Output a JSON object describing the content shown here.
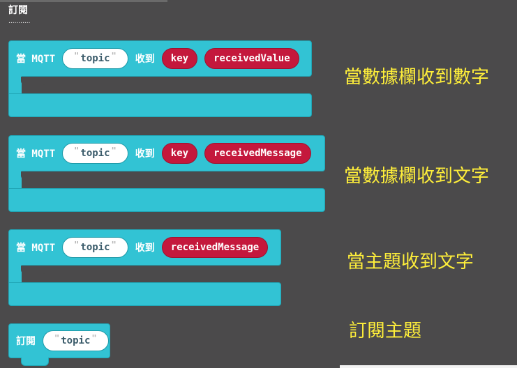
{
  "section": {
    "title": "訂閱",
    "dots": "..........."
  },
  "blocks": [
    {
      "keyword_when": "當 MQTT",
      "topic": "topic",
      "keyword_received": "收到",
      "vars": [
        "key",
        "receivedValue"
      ],
      "caption": "當數據欄收到數字"
    },
    {
      "keyword_when": "當 MQTT",
      "topic": "topic",
      "keyword_received": "收到",
      "vars": [
        "key",
        "receivedMessage"
      ],
      "caption": "當數據欄收到文字"
    },
    {
      "keyword_when": "當 MQTT",
      "topic": "topic",
      "keyword_received": "收到",
      "vars": [
        "receivedMessage"
      ],
      "caption": "當主題收到文字"
    },
    {
      "keyword_subscribe": "訂閱",
      "topic": "topic",
      "caption": "訂閱主題"
    }
  ],
  "colors": {
    "background": "#4b4a4b",
    "block": "#32c3d4",
    "variable": "#c4183c",
    "caption": "#ffef3a"
  }
}
